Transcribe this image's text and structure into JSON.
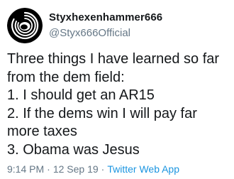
{
  "tweet": {
    "display_name": "Styxhexenhammer666",
    "handle": "@Styx666Official",
    "lines": [
      "Three things I have learned so far",
      "from the dem field:",
      "1. I should get an AR15",
      "2. If the dems win I will pay far",
      "more taxes",
      "3. Obama was Jesus"
    ],
    "time": "9:14 PM",
    "date": "12 Sep 19",
    "separator": "·",
    "source": "Twitter Web App",
    "colors": {
      "name": "#14171a",
      "secondary": "#657786",
      "link": "#1b95e0"
    },
    "avatar_icon": "black-swirl-avatar"
  }
}
